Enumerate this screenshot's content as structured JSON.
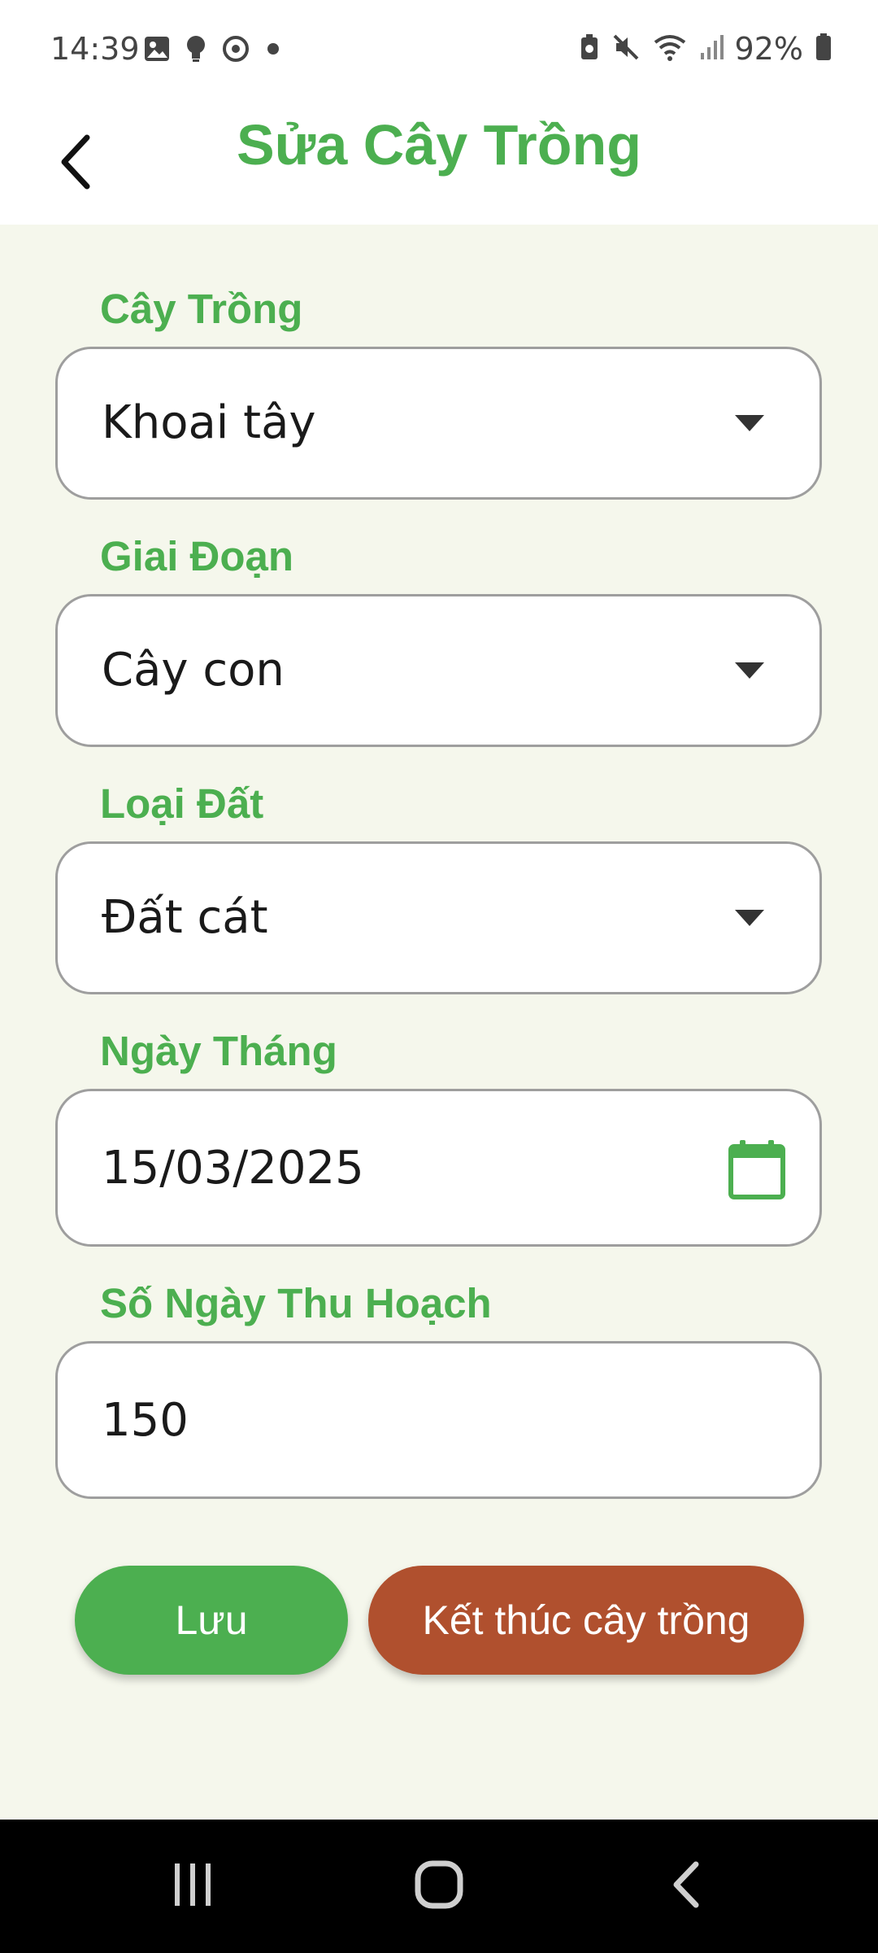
{
  "status_bar": {
    "time": "14:39",
    "battery_percent": "92%",
    "left_icons": [
      "image-icon",
      "lightbulb-icon",
      "sync-icon",
      "dot-icon"
    ],
    "right_icons": [
      "battery-saver-icon",
      "mute-icon",
      "wifi-icon",
      "signal-icon",
      "battery-icon"
    ]
  },
  "app_bar": {
    "title": "Sửa Cây Trồng",
    "back_icon": "chevron-left-icon"
  },
  "form": {
    "crop": {
      "label": "Cây Trồng",
      "value": "Khoai tây"
    },
    "stage": {
      "label": "Giai Đoạn",
      "value": "Cây con"
    },
    "soil": {
      "label": "Loại Đất",
      "value": "Đất cát"
    },
    "date": {
      "label": "Ngày Tháng",
      "value": "15/03/2025"
    },
    "harvest_days": {
      "label": "Số Ngày Thu Hoạch",
      "value": "150"
    }
  },
  "actions": {
    "save_label": "Lưu",
    "end_label": "Kết thúc cây trồng"
  },
  "colors": {
    "accent": "#4caf50",
    "danger": "#b0502e",
    "background": "#f5f7ec"
  },
  "nav_bar": {
    "icons": [
      "recent-apps-icon",
      "home-icon",
      "back-icon"
    ]
  }
}
